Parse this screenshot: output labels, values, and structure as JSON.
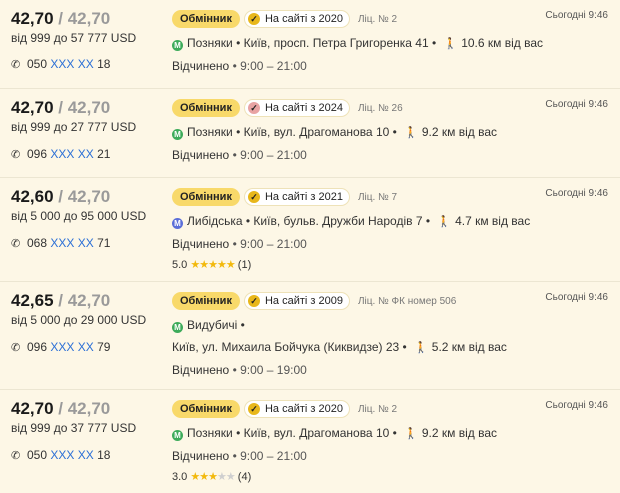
{
  "rows": [
    {
      "buy": "42,70",
      "sell": "42,70",
      "range": "від 999 до 57 777 USD",
      "phone_prefix": "050",
      "phone_mask": "XXX XX",
      "phone_suffix": "18",
      "type": "Обмінник",
      "site": "На сайті з 2020",
      "license": "Ліц. № 2",
      "metro_color": "green",
      "metro": "Позняки",
      "address": " • Київ, просп. Петра Григоренка 41 • ",
      "distance": "10.6  км від вас",
      "status": "Відчинено",
      "hours": " • 9:00 – 21:00",
      "time": "Сьогодні 9:46"
    },
    {
      "buy": "42,70",
      "sell": "42,70",
      "range": "від 999 до 27 777 USD",
      "phone_prefix": "096",
      "phone_mask": "XXX XX",
      "phone_suffix": "21",
      "type": "Обмінник",
      "site": "На сайті з 2024",
      "license": "Ліц. № 26",
      "metro_color": "green",
      "metro": "Позняки",
      "address": " • Київ, вул. Драгоманова 10 • ",
      "distance": "9.2  км від вас",
      "status": "Відчинено",
      "hours": " • 9:00 – 21:00",
      "time": "Сьогодні 9:46"
    },
    {
      "buy": "42,60",
      "sell": "42,70",
      "range": "від 5 000 до 95 000 USD",
      "phone_prefix": "068",
      "phone_mask": "XXX XX",
      "phone_suffix": "71",
      "type": "Обмінник",
      "site": "На сайті з 2021",
      "license": "Ліц. № 7",
      "metro_color": "blue",
      "metro": "Либідська",
      "address": " • Київ, бульв. Дружби Народів 7 • ",
      "distance": "4.7  км від вас",
      "status": "Відчинено",
      "hours": " • 9:00 – 21:00",
      "rating": "5.0",
      "rating_stars": 5,
      "reviews": "(1)",
      "time": "Сьогодні 9:46"
    },
    {
      "buy": "42,65",
      "sell": "42,70",
      "range": "від 5 000 до 29 000 USD",
      "phone_prefix": "096",
      "phone_mask": "XXX XX",
      "phone_suffix": "79",
      "type": "Обмінник",
      "site": "На сайті з 2009",
      "license": "Ліц. № ФК номер 506",
      "metro_color": "green",
      "metro": "Видубичі",
      "address": " •",
      "address2": "Київ, ул. Михаила Бойчука (Киквидзе) 23 • ",
      "distance": "5.2  км від вас",
      "status": "Відчинено",
      "hours": " • 9:00 – 19:00",
      "time": "Сьогодні 9:46"
    },
    {
      "buy": "42,70",
      "sell": "42,70",
      "range": "від 999 до 37 777 USD",
      "phone_prefix": "050",
      "phone_mask": "XXX XX",
      "phone_suffix": "18",
      "type": "Обмінник",
      "site": "На сайті з 2020",
      "license": "Ліц. № 2",
      "metro_color": "green",
      "metro": "Позняки",
      "address": " • Київ, вул. Драгоманова 10 • ",
      "distance": "9.2  км від вас",
      "status": "Відчинено",
      "hours": " • 9:00 – 21:00",
      "rating": "3.0",
      "rating_stars": 3,
      "reviews": "(4)",
      "time": "Сьогодні 9:46"
    }
  ],
  "colors": {
    "accent_badge": "#f8d96a",
    "link": "#2b6fd6",
    "star": "#f2b90d",
    "bg": "#fdf7e6"
  },
  "icons": {
    "phone": "phone-icon",
    "metro": "metro-icon",
    "walk": "walk-icon",
    "verified": "verified-check-icon",
    "star": "star-icon"
  }
}
